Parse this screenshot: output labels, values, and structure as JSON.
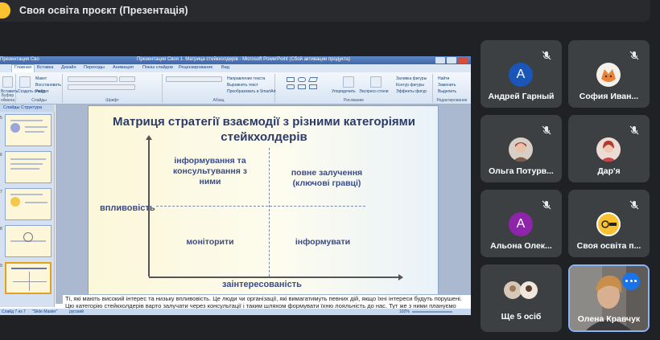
{
  "meeting": {
    "title": "Своя освіта проєкт (Презентація)"
  },
  "powerpoint": {
    "file_label": "Презентация Сво",
    "window_title": "Презентация Своя 1. Матрица стейкхолдерів   -   Microsoft PowerPoint (Сбой активации продукта)",
    "tabs": [
      "Главная",
      "Вставка",
      "Дизайн",
      "Переходы",
      "Анимация",
      "Показ слайдов",
      "Рецензирование",
      "Вид"
    ],
    "ribbon": {
      "clipboard": {
        "paste": "Вставить",
        "label": "Буфер обмена"
      },
      "slides": {
        "create": "Создать слайд",
        "layout": "Макет",
        "reset": "Восстановить",
        "section": "Раздел",
        "label": "Слайды"
      },
      "font": {
        "label": "Шрифт"
      },
      "paragraph": {
        "direction": "Направление текста",
        "align": "Выровнять текст",
        "smartart": "Преобразовать в SmartArt",
        "label": "Абзац"
      },
      "drawing": {
        "arrange": "Упорядочить",
        "styles": "Экспресс-стили",
        "fill": "Заливка фигуры",
        "outline": "Контур фигуры",
        "effects": "Эффекты фигур",
        "label": "Рисование"
      },
      "editing": {
        "find": "Найти",
        "replace": "Заменить",
        "select": "Выделить",
        "label": "Редактирование"
      }
    },
    "left_tabs": {
      "slides": "Слайды",
      "outline": "Структура"
    },
    "thumbnail_numbers": [
      "5",
      "6",
      "7",
      "8",
      "9"
    ],
    "slide": {
      "title": "Матриця стратегії взаємодії з різними категоріями стейкхолдерів",
      "quadrant_top_left": "інформування та консультування з ними",
      "quadrant_top_right": "повне залучення (ключові гравці)",
      "quadrant_bottom_left": "моніторити",
      "quadrant_bottom_right": "інформувати",
      "y_label": "впливовість",
      "x_label": "заінтересованість"
    },
    "notes": "Ті, які мають високий інтерес та низьку впливовість. Це люди чи організації, які вимагатимуть певних дій, якщо їхні інтереси будуть порушені. Цю категорію стейкхолдерів варто залучати через консультації і таким шляхом формувати їхню лояльність до нас. Тут же з ними плануємо через",
    "status": {
      "slide": "Слайд 7 из 7",
      "theme": "\"Slide Master\"",
      "lang": "русский",
      "zoom": "102%"
    }
  },
  "participants": [
    {
      "name": "Андрей Гарный",
      "avatar": "letter",
      "letter": "A",
      "color": "#1a56b8"
    },
    {
      "name": "София Иван...",
      "avatar": "photo",
      "color": "#f4f1ea"
    },
    {
      "name": "Ольга Потурв...",
      "avatar": "photo",
      "color": "#9c6b4a"
    },
    {
      "name": "Дар'я",
      "avatar": "photo",
      "color": "#c0463f"
    },
    {
      "name": "Альона Олек...",
      "avatar": "letter",
      "letter": "A",
      "color": "#8e24aa"
    },
    {
      "name": "Своя освіта п...",
      "avatar": "logo",
      "color": "#f9c22e"
    },
    {
      "name": "Ще 5 осіб",
      "avatar": "group"
    },
    {
      "name": "Олена Кравчук",
      "avatar": "video"
    }
  ]
}
